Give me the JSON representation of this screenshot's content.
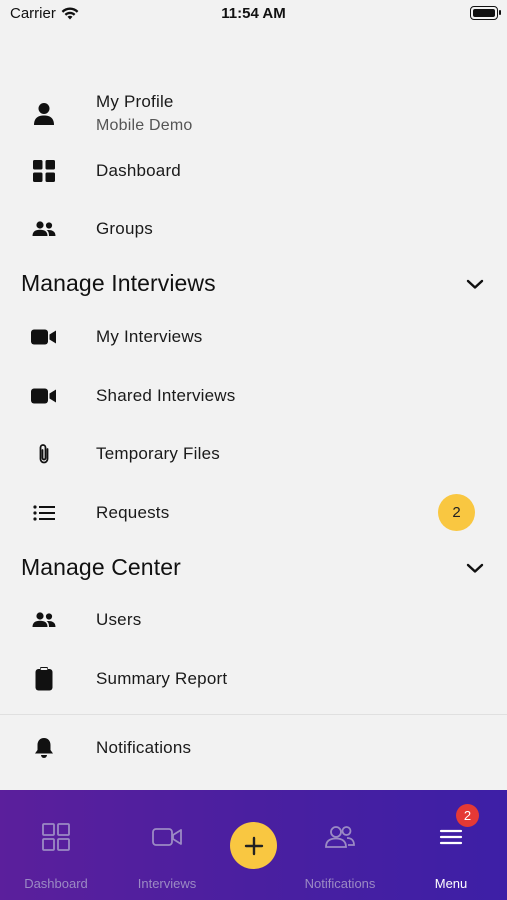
{
  "status_bar": {
    "carrier": "Carrier",
    "time": "11:54 AM"
  },
  "profile": {
    "name": "My Profile",
    "subtitle": "Mobile Demo",
    "icon": "person-icon"
  },
  "top_items": [
    {
      "label": "Dashboard",
      "icon": "grid-icon"
    },
    {
      "label": "Groups",
      "icon": "people-icon"
    }
  ],
  "section_interviews": {
    "title": "Manage Interviews",
    "items": [
      {
        "label": "My Interviews",
        "icon": "video-icon"
      },
      {
        "label": "Shared Interviews",
        "icon": "video-icon"
      },
      {
        "label": "Temporary Files",
        "icon": "paperclip-icon"
      },
      {
        "label": "Requests",
        "icon": "list-icon",
        "badge": "2"
      }
    ]
  },
  "section_center": {
    "title": "Manage Center",
    "items": [
      {
        "label": "Users",
        "icon": "people-icon"
      },
      {
        "label": "Summary Report",
        "icon": "clipboard-icon"
      }
    ]
  },
  "notifications_item": {
    "label": "Notifications",
    "icon": "bell-icon"
  },
  "tab_bar": {
    "tabs": [
      {
        "label": "Dashboard",
        "icon": "grid-outline-icon",
        "active": false
      },
      {
        "label": "Interviews",
        "icon": "video-outline-icon",
        "active": false
      },
      {
        "label": "Notifications",
        "icon": "people-outline-icon",
        "active": false
      },
      {
        "label": "Menu",
        "icon": "hamburger-icon",
        "active": true,
        "badge": "2"
      }
    ],
    "fab_icon": "plus-icon"
  },
  "colors": {
    "accent_yellow": "#f9c741",
    "tab_bar_purple": "#4a1fa0",
    "badge_red": "#e53935"
  }
}
